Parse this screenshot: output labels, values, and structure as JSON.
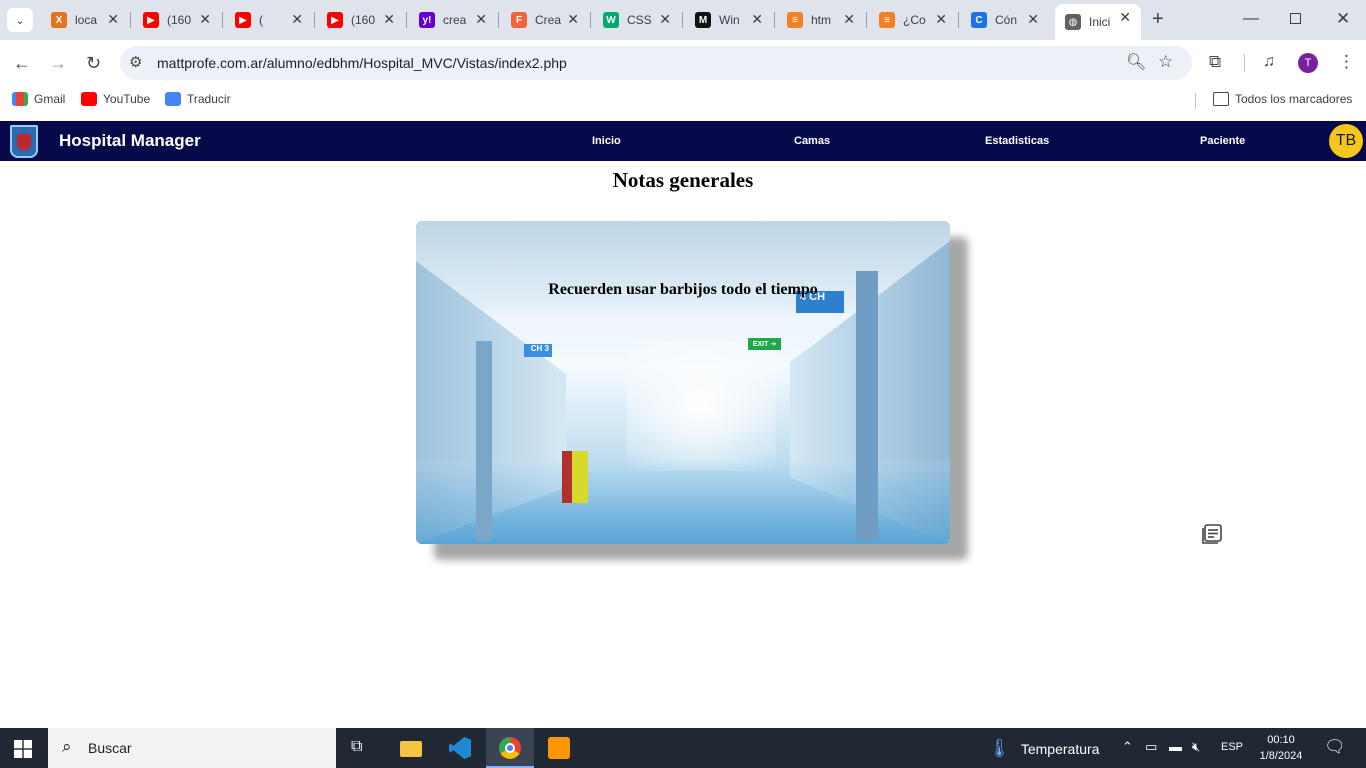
{
  "browser": {
    "tabs": [
      {
        "title": "loca",
        "color": "#e8711c",
        "glyph": "X"
      },
      {
        "title": "(160",
        "color": "#ff0000",
        "glyph": "▶"
      },
      {
        "title": "(",
        "color": "#ff0000",
        "glyph": "▶"
      },
      {
        "title": "(160",
        "color": "#ff0000",
        "glyph": "▶"
      },
      {
        "title": "crea",
        "color": "#6001d2",
        "glyph": "y!"
      },
      {
        "title": "Crea",
        "color": "#f4623a",
        "glyph": "F"
      },
      {
        "title": "CSS",
        "color": "#04aa6d",
        "glyph": "W"
      },
      {
        "title": "Win",
        "color": "#111111",
        "glyph": "M"
      },
      {
        "title": "htm",
        "color": "#f48024",
        "glyph": "≡"
      },
      {
        "title": "¿Co",
        "color": "#f48024",
        "glyph": "≡"
      },
      {
        "title": "Cón",
        "color": "#1a73e8",
        "glyph": "C"
      },
      {
        "title": "Inici",
        "color": "#5f6368",
        "glyph": "◍"
      }
    ],
    "url": "mattprofe.com.ar/alumno/edbhm/Hospital_MVC/Vistas/index2.php",
    "profile_initial": "T",
    "bookmarks": [
      {
        "label": "Gmail"
      },
      {
        "label": "YouTube"
      },
      {
        "label": "Traducir"
      }
    ],
    "all_bookmarks_label": "Todos los marcadores"
  },
  "app": {
    "brand": "Hospital Manager",
    "nav": [
      "Inicio",
      "Camas",
      "Estadisticas",
      "Paciente"
    ],
    "user_initials": "TB",
    "heading": "Notas generales",
    "card_text": "Recuerden usar barbijos todo el tiempo",
    "card_signs": {
      "exit": "EXIT ➔",
      "ch4": "4 CH",
      "ch3": "CH 3"
    }
  },
  "taskbar": {
    "search_label": "Buscar",
    "weather_label": "Temperatura",
    "language": "ESP",
    "time": "00:10",
    "date": "1/8/2024"
  },
  "colors": {
    "navbar": "#060a4a",
    "avatar": "#f5c71a",
    "accent": "#1a73e8"
  }
}
